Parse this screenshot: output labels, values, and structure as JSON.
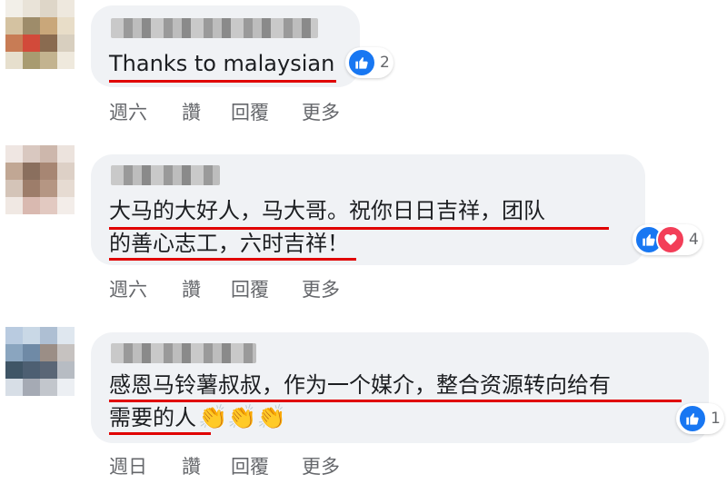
{
  "comments": [
    {
      "text_lines": [
        "Thanks to malaysian"
      ],
      "reaction_count": "2",
      "reactions": [
        "like-icon"
      ],
      "actions": [
        "週六",
        "讚",
        "回覆",
        "更多"
      ]
    },
    {
      "text_lines": [
        "大马的大好人，马大哥。祝你日日吉祥，团队",
        "的善心志工，六时吉祥！"
      ],
      "reaction_count": "4",
      "reactions": [
        "like-icon",
        "love-icon"
      ],
      "actions": [
        "週六",
        "讚",
        "回覆",
        "更多"
      ]
    },
    {
      "text_lines": [
        "感恩马铃薯叔叔，作为一个媒介，整合资源转向给有",
        "需要的人"
      ],
      "emoji": "👏👏👏",
      "reaction_count": "1",
      "reactions": [
        "like-icon"
      ],
      "actions": [
        "週日",
        "讚",
        "回覆",
        "更多"
      ]
    }
  ],
  "colors": {
    "bubble": "#f0f2f5",
    "like": "#1877f2",
    "love": "#f33e58",
    "underline": "#e00000",
    "meta_text": "#65676b"
  }
}
